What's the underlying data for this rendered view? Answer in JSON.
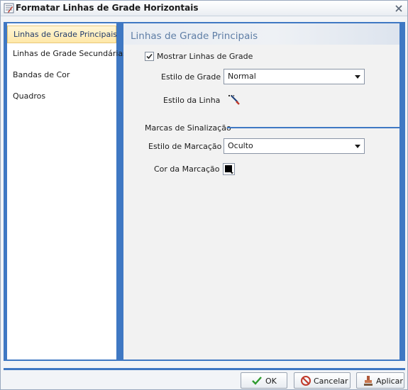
{
  "window": {
    "title": "Formatar Linhas de Grade Horizontais"
  },
  "nav": {
    "items": [
      {
        "label": "Linhas de Grade Principais",
        "selected": true
      },
      {
        "label": "Linhas de Grade Secundárias",
        "selected": false
      },
      {
        "label": "Bandas de Cor",
        "selected": false
      },
      {
        "label": "Quadros",
        "selected": false
      }
    ]
  },
  "panel": {
    "header": "Linhas de Grade Principais",
    "show_grid": {
      "label": "Mostrar Linhas de Grade",
      "checked": true
    },
    "grid_style": {
      "label": "Estilo de Grade",
      "value": "Normal"
    },
    "line_style": {
      "label": "Estilo da Linha"
    },
    "marks_section": {
      "label": "Marcas de Sinalização"
    },
    "mark_style": {
      "label": "Estilo de Marcação",
      "value": "Oculto"
    },
    "mark_color": {
      "label": "Cor da Marcação",
      "color": "#000000"
    }
  },
  "buttons": {
    "ok": "OK",
    "cancel": "Cancelar",
    "apply": "Aplicar"
  },
  "colors": {
    "accent": "#3f78c3",
    "header_text": "#5f7ea6"
  }
}
